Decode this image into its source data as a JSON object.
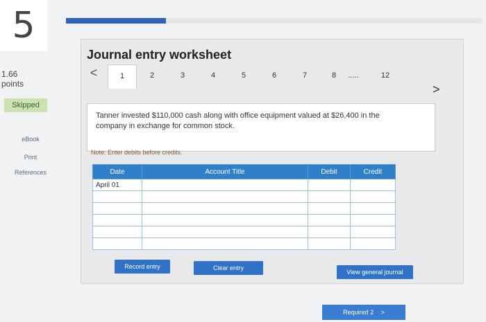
{
  "question": {
    "number": "5",
    "points_value": "1.66",
    "points_label": "points",
    "status": "Skipped",
    "progress_fraction": 0.24
  },
  "sidebar": {
    "ebook": "eBook",
    "print": "Print",
    "references": "References"
  },
  "worksheet": {
    "title": "Journal entry worksheet",
    "prev": "<",
    "next": ">",
    "tabs": [
      "1",
      "2",
      "3",
      "4",
      "5",
      "6",
      "7",
      "8",
      ".....",
      "12"
    ],
    "active_tab": "1",
    "prompt": "Tanner invested $110,000 cash along with office equipment valued at $26,400 in the company in exchange for common stock.",
    "note": "Note: Enter debits before credits."
  },
  "journal": {
    "headers": {
      "date": "Date",
      "account": "Account Title",
      "debit": "Debit",
      "credit": "Credit"
    },
    "first_date": "April 01"
  },
  "buttons": {
    "record": "Record entry",
    "clear": "Clear entry",
    "view": "View general journal",
    "required": "Required 2",
    "required_arrow": ">"
  },
  "colors": {
    "accent": "#2f72c8",
    "header": "#2f7fc9",
    "skipped_bg": "#cce3b1"
  }
}
